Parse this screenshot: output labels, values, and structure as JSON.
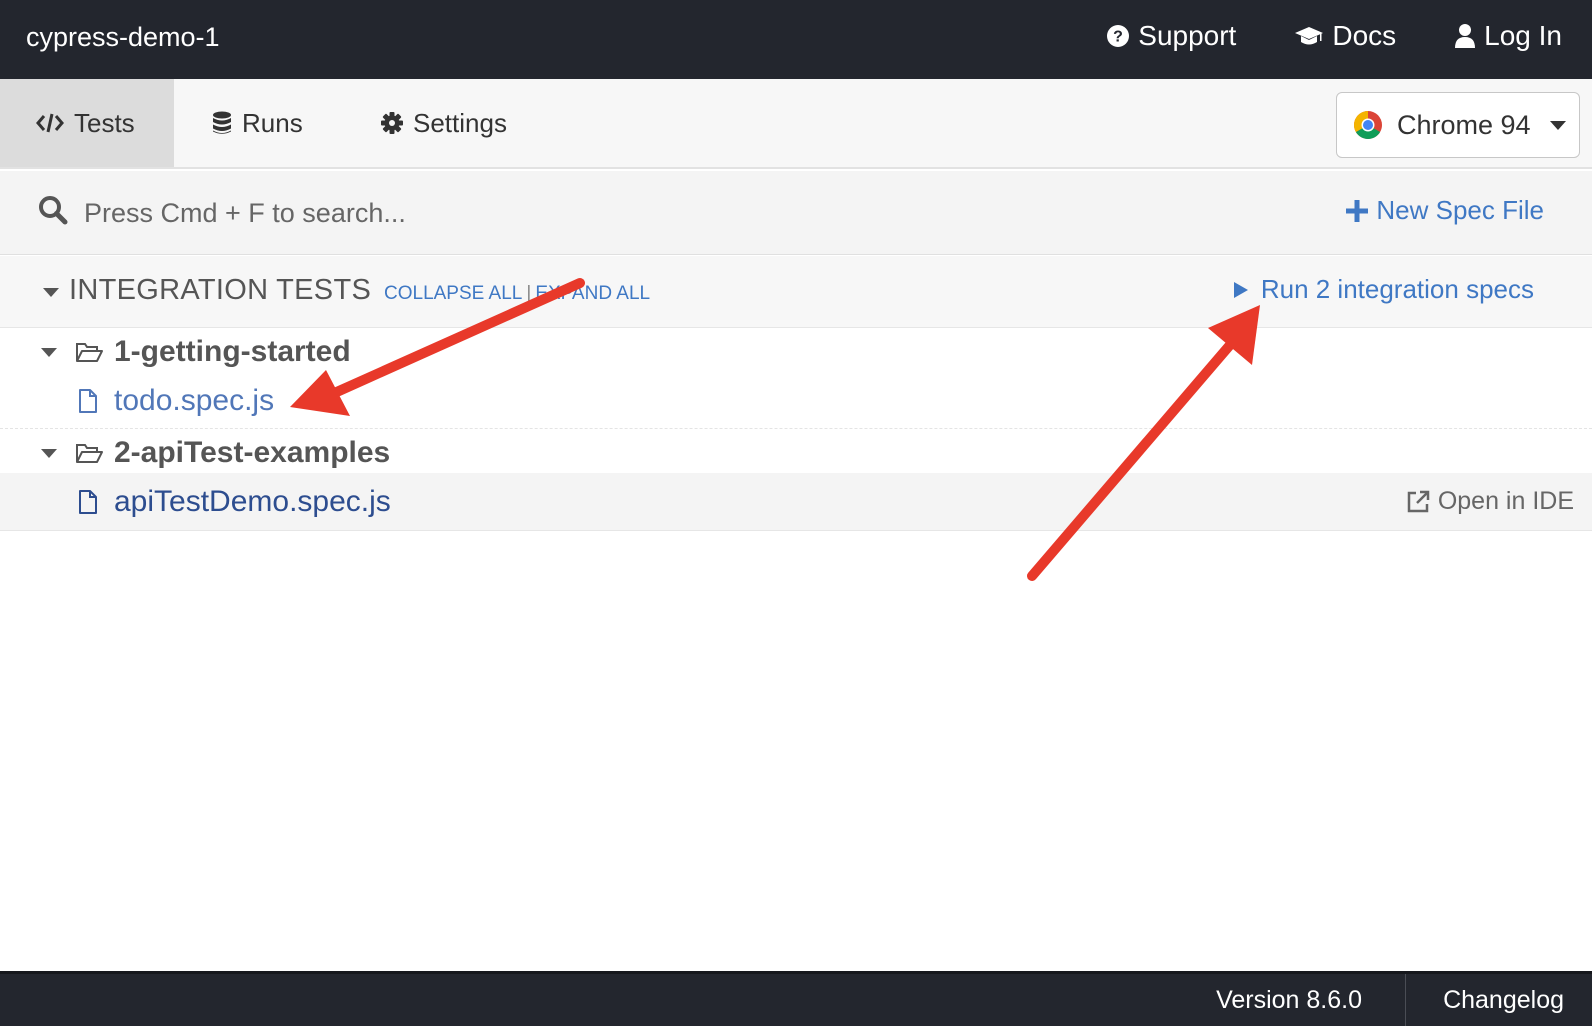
{
  "header": {
    "project_title": "cypress-demo-1",
    "links": {
      "support": "Support",
      "docs": "Docs",
      "login": "Log In"
    }
  },
  "nav": {
    "tabs": {
      "tests": "Tests",
      "runs": "Runs",
      "settings": "Settings"
    },
    "active_tab": "Tests",
    "browser": "Chrome 94"
  },
  "search": {
    "placeholder": "Press Cmd + F to search...",
    "value": "",
    "new_spec_label": "New Spec File"
  },
  "section": {
    "title": "INTEGRATION TESTS",
    "collapse_all": "COLLAPSE ALL",
    "separator": "|",
    "expand_all": "EXPAND ALL",
    "run_all": "Run 2 integration specs"
  },
  "tree": {
    "folders": [
      {
        "name": "1-getting-started",
        "files": [
          {
            "name": "todo.spec.js"
          }
        ]
      },
      {
        "name": "2-apiTest-examples",
        "files": [
          {
            "name": "apiTestDemo.spec.js",
            "action": "Open in IDE"
          }
        ]
      }
    ]
  },
  "footer": {
    "version": "Version 8.6.0",
    "changelog": "Changelog"
  },
  "colors": {
    "topbar": "#23262e",
    "link_blue": "#3f78c4",
    "annotation_red": "#e8392a"
  }
}
